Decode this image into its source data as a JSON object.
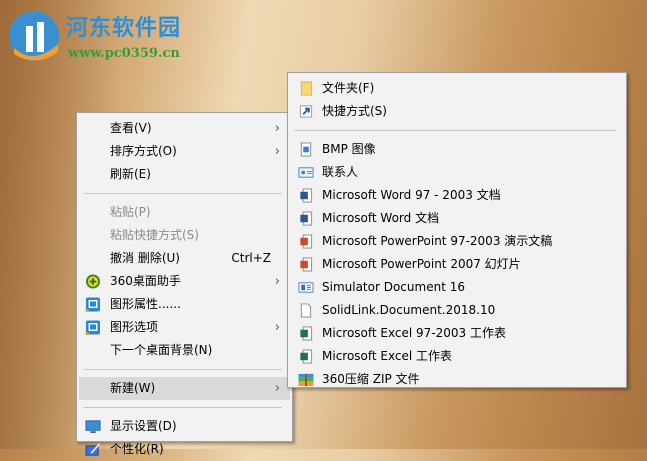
{
  "watermark": {
    "brand": "河东软件园",
    "url": "www.pc0359.cn"
  },
  "context_menu": {
    "items": [
      {
        "label": "查看(V)",
        "submenu": true
      },
      {
        "label": "排序方式(O)",
        "submenu": true
      },
      {
        "label": "刷新(E)"
      },
      {
        "label": "粘贴(P)",
        "disabled": true
      },
      {
        "label": "粘贴快捷方式(S)",
        "disabled": true
      },
      {
        "label": "撤消 删除(U)",
        "shortcut": "Ctrl+Z"
      },
      {
        "label": "360桌面助手",
        "icon": "360-icon",
        "submenu": true
      },
      {
        "label": "图形属性......",
        "icon": "intel-graphics-icon"
      },
      {
        "label": "图形选项",
        "icon": "intel-graphics-icon",
        "submenu": true
      },
      {
        "label": "下一个桌面背景(N)"
      },
      {
        "label": "新建(W)",
        "submenu": true,
        "highlighted": true
      },
      {
        "label": "显示设置(D)",
        "icon": "display-icon"
      },
      {
        "label": "个性化(R)",
        "icon": "personalize-icon"
      }
    ]
  },
  "new_submenu": {
    "items": [
      {
        "label": "文件夹(F)",
        "icon": "folder-icon"
      },
      {
        "label": "快捷方式(S)",
        "icon": "shortcut-icon"
      },
      {
        "label": "BMP 图像",
        "icon": "bmp-icon"
      },
      {
        "label": "联系人",
        "icon": "contact-icon"
      },
      {
        "label": "Microsoft Word 97 - 2003 文档",
        "icon": "word-icon"
      },
      {
        "label": "Microsoft Word 文档",
        "icon": "word-icon"
      },
      {
        "label": "Microsoft PowerPoint 97-2003 演示文稿",
        "icon": "powerpoint-icon"
      },
      {
        "label": "Microsoft PowerPoint 2007 幻灯片",
        "icon": "powerpoint-icon"
      },
      {
        "label": "Simulator Document 16",
        "icon": "simulator-icon"
      },
      {
        "label": "SolidLink.Document.2018.10",
        "icon": "blank-file-icon"
      },
      {
        "label": "Microsoft Excel 97-2003 工作表",
        "icon": "excel-icon"
      },
      {
        "label": "Microsoft Excel 工作表",
        "icon": "excel-icon"
      },
      {
        "label": "360压缩 ZIP 文件",
        "icon": "zip-icon"
      }
    ]
  },
  "colors": {
    "menu_bg": "#f2f2f2",
    "highlight": "#d9d9d9",
    "disabled": "#8a8a8a"
  }
}
